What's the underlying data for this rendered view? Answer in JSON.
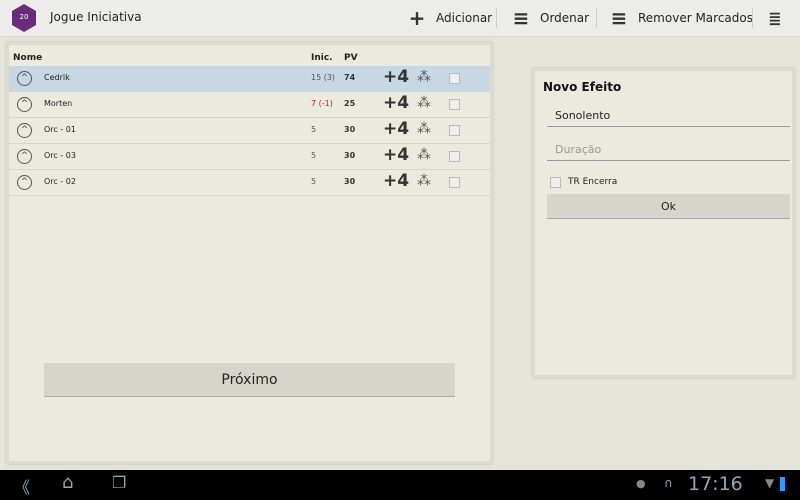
{
  "app": {
    "title": "Jogue Iniciativa",
    "logo_text": "20"
  },
  "actions": [
    {
      "label": "Adicionar",
      "icon": "plus-icon"
    },
    {
      "label": "Ordenar",
      "icon": "sort-icon"
    },
    {
      "label": "Remover Marcados",
      "icon": "remove-marked-icon"
    },
    {
      "icon": "overflow-menu-icon"
    }
  ],
  "table": {
    "headers": {
      "name": "Nome",
      "init": "Inic.",
      "hp": "PV"
    },
    "rows": [
      {
        "name": "Cedrik",
        "init": "15 (3)",
        "hp": "74",
        "selected": true
      },
      {
        "name": "Morten",
        "init": "7 (-1)",
        "hp": "25",
        "init_color": "#b22222"
      },
      {
        "name": "Orc - 01",
        "init": "5",
        "hp": "30"
      },
      {
        "name": "Orc - 03",
        "init": "5",
        "hp": "30"
      },
      {
        "name": "Orc - 02",
        "init": "5",
        "hp": "30"
      }
    ]
  },
  "next_button": "Próximo",
  "effect": {
    "title": "Novo Efeito",
    "name_value": "Sonolento",
    "duration_placeholder": "Duração",
    "tr_label": "TR Encerra",
    "ok": "Ok"
  },
  "status": {
    "time": "17:16"
  }
}
